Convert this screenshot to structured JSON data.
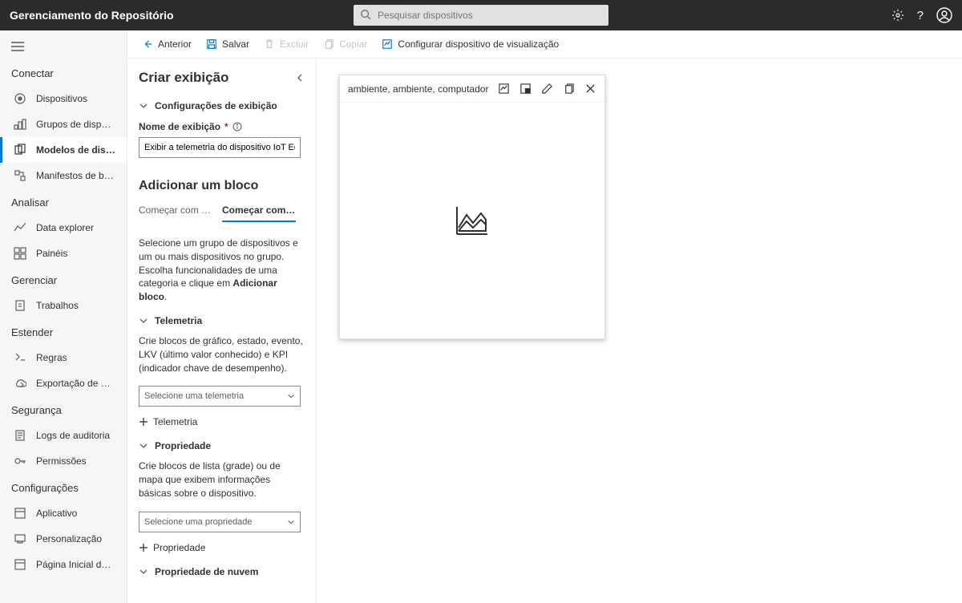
{
  "header": {
    "brand": "Gerenciamento do Repositório",
    "search_placeholder": "Pesquisar dispositivos"
  },
  "sidebar": {
    "groups": [
      {
        "header": "Conectar",
        "items": [
          {
            "label": "Dispositivos"
          },
          {
            "label": "Grupos de dispositivos"
          },
          {
            "label": "Modelos de dispo...",
            "active": true
          },
          {
            "label": "Manifestos de borda"
          }
        ]
      },
      {
        "header": "Analisar",
        "items": [
          {
            "label": "Data explorer"
          },
          {
            "label": "Painéis"
          }
        ]
      },
      {
        "header": "Gerenciar",
        "items": [
          {
            "label": "Trabalhos"
          }
        ]
      },
      {
        "header": "Estender",
        "items": [
          {
            "label": "Regras"
          },
          {
            "label": "Exportação de dados"
          }
        ]
      },
      {
        "header": "Segurança",
        "items": [
          {
            "label": "Logs de auditoria"
          },
          {
            "label": "Permissões"
          }
        ]
      },
      {
        "header": "Configurações",
        "items": [
          {
            "label": "Aplicativo"
          },
          {
            "label": "Personalização"
          },
          {
            "label": "Página Inicial do IoT C"
          }
        ]
      }
    ]
  },
  "cmdbar": {
    "back": "Anterior",
    "save": "Salvar",
    "delete": "Excluir",
    "copy": "Copiar",
    "preview": "Configurar dispositivo de visualização"
  },
  "panel": {
    "title": "Criar exibição",
    "section_view_settings": "Configurações de exibição",
    "display_name_label": "Nome de exibição",
    "display_name_value": "Exibir a telemetria do dispositivo IoT Edge",
    "add_tile_heading": "Adicionar um bloco",
    "tabs": {
      "visual": "Começar com u...",
      "devices": "Começar com d..."
    },
    "instructions_pre": "Selecione um grupo de dispositivos e um ou mais dispositivos no grupo. Escolha funcionalidades de uma categoria e clique em ",
    "instructions_bold": "Adicionar bloco",
    "telemetry": {
      "header": "Telemetria",
      "desc": "Crie blocos de gráfico, estado, evento, LKV (último valor conhecido) e KPI (indicador chave de desempenho).",
      "select_placeholder": "Selecione uma telemetria",
      "add": "Telemetria"
    },
    "property": {
      "header": "Propriedade",
      "desc": "Crie blocos de lista (grade) ou de mapa que exibem informações básicas sobre o dispositivo.",
      "select_placeholder": "Selecione uma propriedade",
      "add": "Propriedade"
    },
    "cloud_property_header": "Propriedade de nuvem"
  },
  "tile": {
    "title": "ambiente, ambiente, computador"
  }
}
